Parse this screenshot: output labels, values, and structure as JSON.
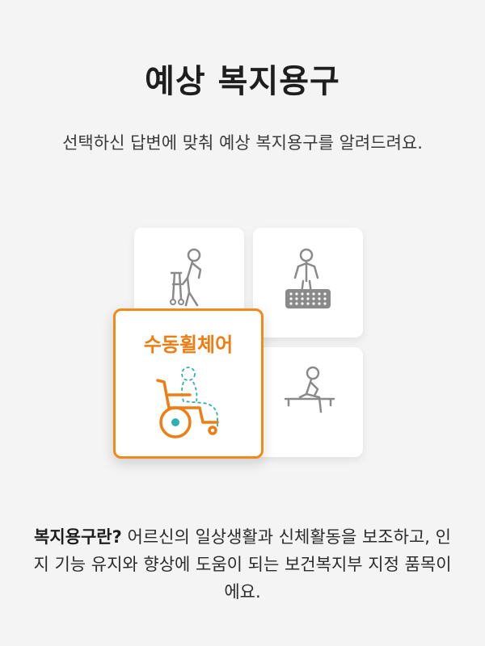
{
  "title": "예상 복지용구",
  "subtitle": "선택하신 답변에 맞춰 예상 복지용구를 알려드려요.",
  "featured_item": {
    "label": "수동휠체어",
    "accent_color": "#ef7d12",
    "icon": "wheelchair-icon"
  },
  "other_items": [
    {
      "icon": "walker-icon"
    },
    {
      "icon": "bath-mat-icon"
    },
    {
      "icon": "bath-bench-icon"
    }
  ],
  "description": {
    "heading": "복지용구란?",
    "body": " 어르신의 일상생활과 신체활동을 보조하고, 인지 기능 유지와 향상에 도움이 되는 보건복지부 지정 품목이에요."
  }
}
